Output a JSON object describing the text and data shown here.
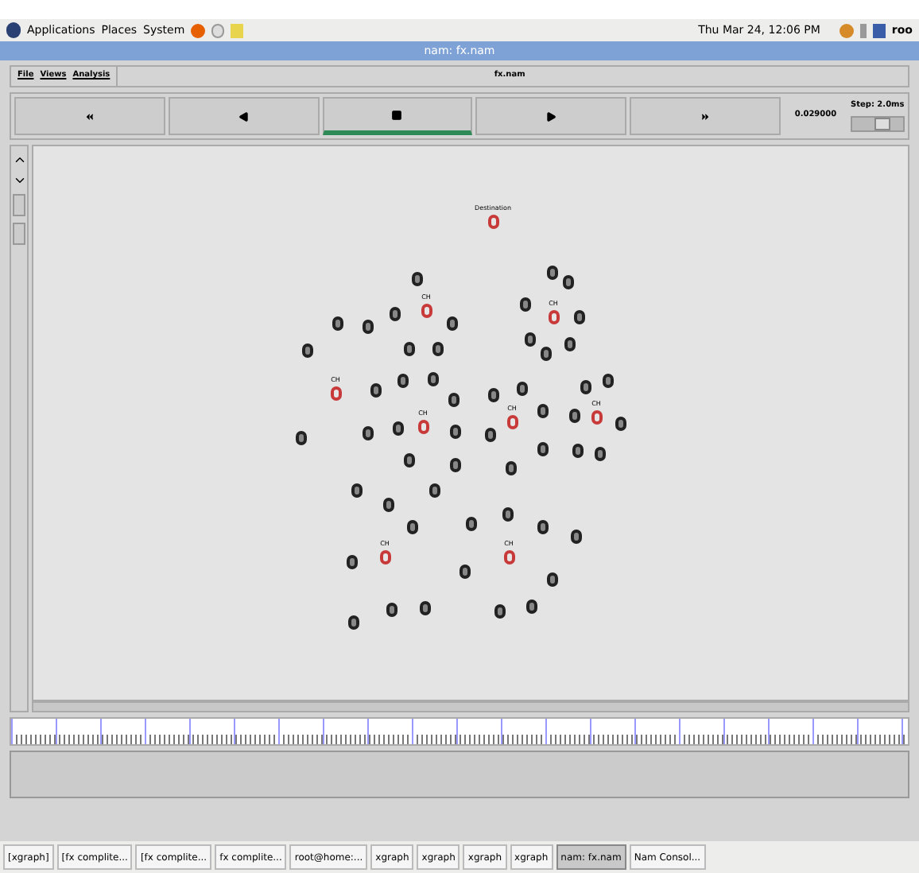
{
  "panel": {
    "menus": [
      "Applications",
      "Places",
      "System"
    ],
    "clock": "Thu Mar 24, 12:06 PM",
    "user": "roo"
  },
  "window": {
    "title": "nam: fx.nam"
  },
  "menubar": {
    "items": [
      "File",
      "Views",
      "Analysis"
    ],
    "file_name": "fx.nam"
  },
  "controls": {
    "buttons": [
      {
        "kind": "rewind",
        "selected": false
      },
      {
        "kind": "back",
        "selected": false
      },
      {
        "kind": "stop",
        "selected": true
      },
      {
        "kind": "play",
        "selected": false
      },
      {
        "kind": "forward",
        "selected": false
      }
    ],
    "time": "0.029000",
    "step": "Step: 2.0ms",
    "step_slider": {
      "level": 0.6
    }
  },
  "nodes": [
    {
      "kind": "head",
      "label": "Destination"
    },
    {
      "kind": "head",
      "label": "CH"
    },
    {
      "kind": "head",
      "label": "CH"
    },
    {
      "kind": "head",
      "label": "CH"
    },
    {
      "kind": "head",
      "label": "CH"
    },
    {
      "kind": "head",
      "label": "CH"
    },
    {
      "kind": "head",
      "label": "CH"
    },
    {
      "kind": "head",
      "label": "CH"
    },
    {
      "kind": "head",
      "label": "CH"
    }
  ],
  "taskbar": [
    {
      "label": "[xgraph]",
      "selected": false
    },
    {
      "label": "[fx complite...",
      "selected": false
    },
    {
      "label": "[fx complite...",
      "selected": false
    },
    {
      "label": "fx complite...",
      "selected": false
    },
    {
      "label": "root@home:...",
      "selected": false
    },
    {
      "label": "xgraph",
      "selected": false
    },
    {
      "label": "xgraph",
      "selected": false
    },
    {
      "label": "xgraph",
      "selected": false
    },
    {
      "label": "xgraph",
      "selected": false
    },
    {
      "label": "nam: fx.nam",
      "selected": true
    },
    {
      "label": "Nam Consol...",
      "selected": false
    }
  ]
}
